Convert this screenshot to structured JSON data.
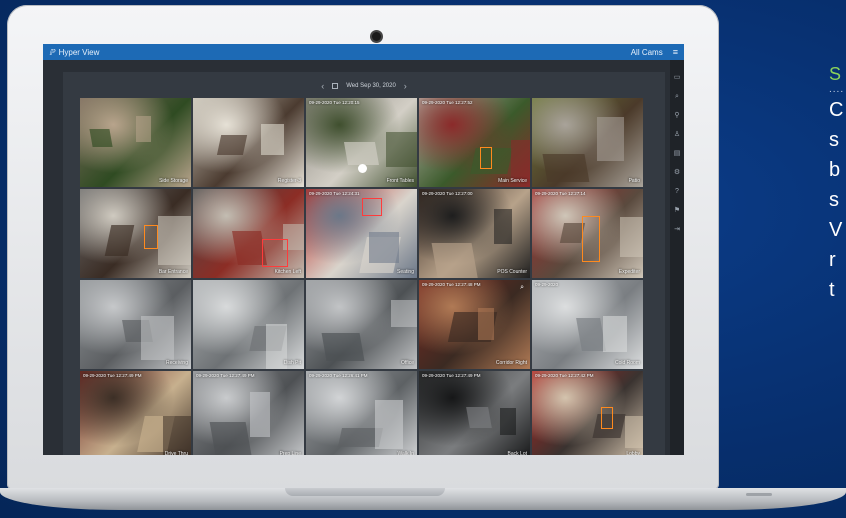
{
  "app": {
    "logo": "ℙ",
    "title": "Hyper View",
    "right_label": "All Cams",
    "menu_icon": "≡"
  },
  "datebar": {
    "prev": "‹",
    "date": "Wed Sep 30, 2020",
    "next": "›"
  },
  "sidebar_icons": [
    "monitor-icon",
    "search-icon",
    "pin-icon",
    "user-icon",
    "print-icon",
    "settings-icon",
    "help-icon",
    "flag-icon",
    "logout-icon"
  ],
  "tiles": [
    {
      "label": "Side Storage",
      "ts": "",
      "colors": [
        "#7a6a5c",
        "#2f4b22",
        "#b8a48c"
      ]
    },
    {
      "label": "Register-3",
      "ts": "",
      "colors": [
        "#c9c4b8",
        "#4b3b30",
        "#e6e1d6"
      ]
    },
    {
      "label": "Front Tables",
      "ts": "09-29-2020 Tue 12:20:15",
      "colors": [
        "#8e8a82",
        "#d3cfc6",
        "#3f4f2e"
      ]
    },
    {
      "label": "Main Service",
      "ts": "09-29-2020 Tue 12:27:52",
      "colors": [
        "#b9b4aa",
        "#3b5a2b",
        "#8b2a2a"
      ]
    },
    {
      "label": "Patio",
      "ts": "",
      "colors": [
        "#6f7a3a",
        "#4b3a2a",
        "#a9a39a"
      ]
    },
    {
      "label": "Bar Entrance",
      "ts": "",
      "colors": [
        "#6b6b6b",
        "#3a2c24",
        "#cfcac0"
      ]
    },
    {
      "label": "Kitchen Left",
      "ts": "",
      "colors": [
        "#4a4a4a",
        "#8c2d25",
        "#c3bdb2"
      ]
    },
    {
      "label": "Seating",
      "ts": "09-29-2020 Tue 12:24:31",
      "colors": [
        "#b8261f",
        "#d9d4cc",
        "#6b7788"
      ]
    },
    {
      "label": "POS Counter",
      "ts": "09-29-2020 Tue 12:27:00",
      "colors": [
        "#3a2a22",
        "#b7a28a",
        "#1e1e1e"
      ]
    },
    {
      "label": "Expediter",
      "ts": "09-29-2020 Tue 12:27:14",
      "colors": [
        "#a32a2a",
        "#5a4a3e",
        "#cfc6b8"
      ]
    },
    {
      "label": "Receiving",
      "ts": "",
      "colors": [
        "#8f9396",
        "#5b5e61",
        "#c6c8ca"
      ]
    },
    {
      "label": "Dish Pit",
      "ts": "",
      "colors": [
        "#aeb1b3",
        "#6e7275",
        "#d8dadb"
      ]
    },
    {
      "label": "Office",
      "ts": "",
      "colors": [
        "#9a9da0",
        "#4d5154",
        "#c2c4c6"
      ]
    },
    {
      "label": "Corridor Right",
      "ts": "09-29-2020 Tue 12:27:48 PM",
      "colors": [
        "#7a2b22",
        "#3b2a22",
        "#b07a55"
      ]
    },
    {
      "label": "Cold Room",
      "ts": "09-29-2020",
      "colors": [
        "#b1b4b7",
        "#7a7e82",
        "#dcdedf"
      ]
    },
    {
      "label": "Drive Thru",
      "ts": "09-29-2020 Tue 12:27:49 PM",
      "colors": [
        "#6d2622",
        "#c7b08e",
        "#3c2f26"
      ]
    },
    {
      "label": "Prep Line",
      "ts": "09-29-2020 Tue 12:27:49 PM",
      "colors": [
        "#8b8d90",
        "#4e5154",
        "#c9cbcd"
      ]
    },
    {
      "label": "Walk In",
      "ts": "09-29-2020 Tue 12:26:41 PM",
      "colors": [
        "#9fa2a5",
        "#5d6164",
        "#d2d4d6"
      ]
    },
    {
      "label": "Back Lot",
      "ts": "09-29-2020 Tue 12:27:49 PM",
      "colors": [
        "#2e2f30",
        "#7b7d7f",
        "#161718"
      ]
    },
    {
      "label": "Lobby",
      "ts": "09-29-2020 Tue 12:27:42 PM",
      "colors": [
        "#b3221e",
        "#3a3330",
        "#d4c4ae"
      ]
    }
  ],
  "side_text": {
    "heading": "S",
    "dots": "....",
    "lines": [
      "C",
      "s",
      "b",
      "s",
      "V",
      "r",
      "t"
    ]
  }
}
